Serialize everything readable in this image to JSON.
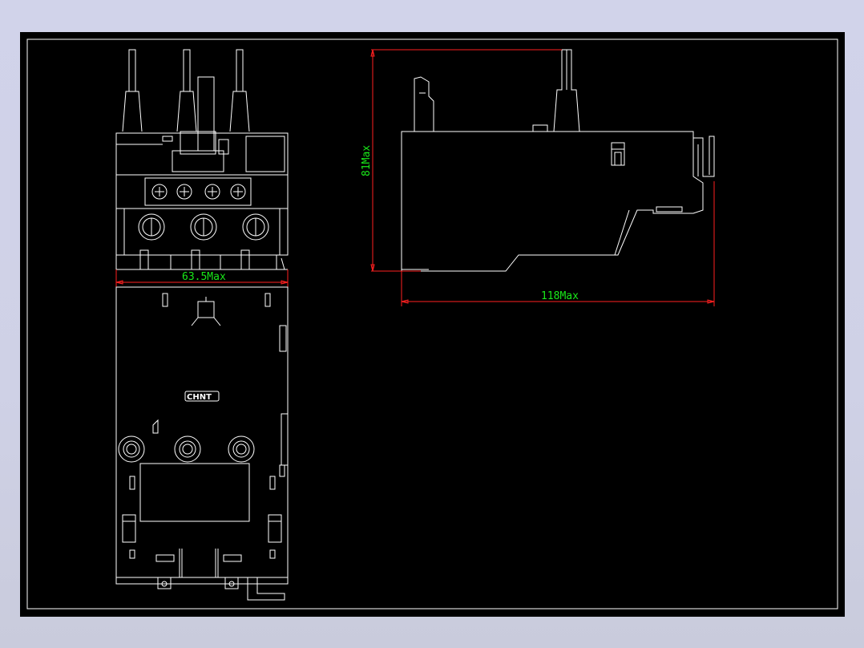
{
  "dimensions": {
    "width_label": "63.5Max",
    "height_label": "81Max",
    "depth_label": "118Max"
  },
  "brand_label": "CHNT",
  "colors": {
    "background": "#000000",
    "lines": "#ffffff",
    "dimension_lines": "#ff2020",
    "dimension_text": "#19e819"
  }
}
